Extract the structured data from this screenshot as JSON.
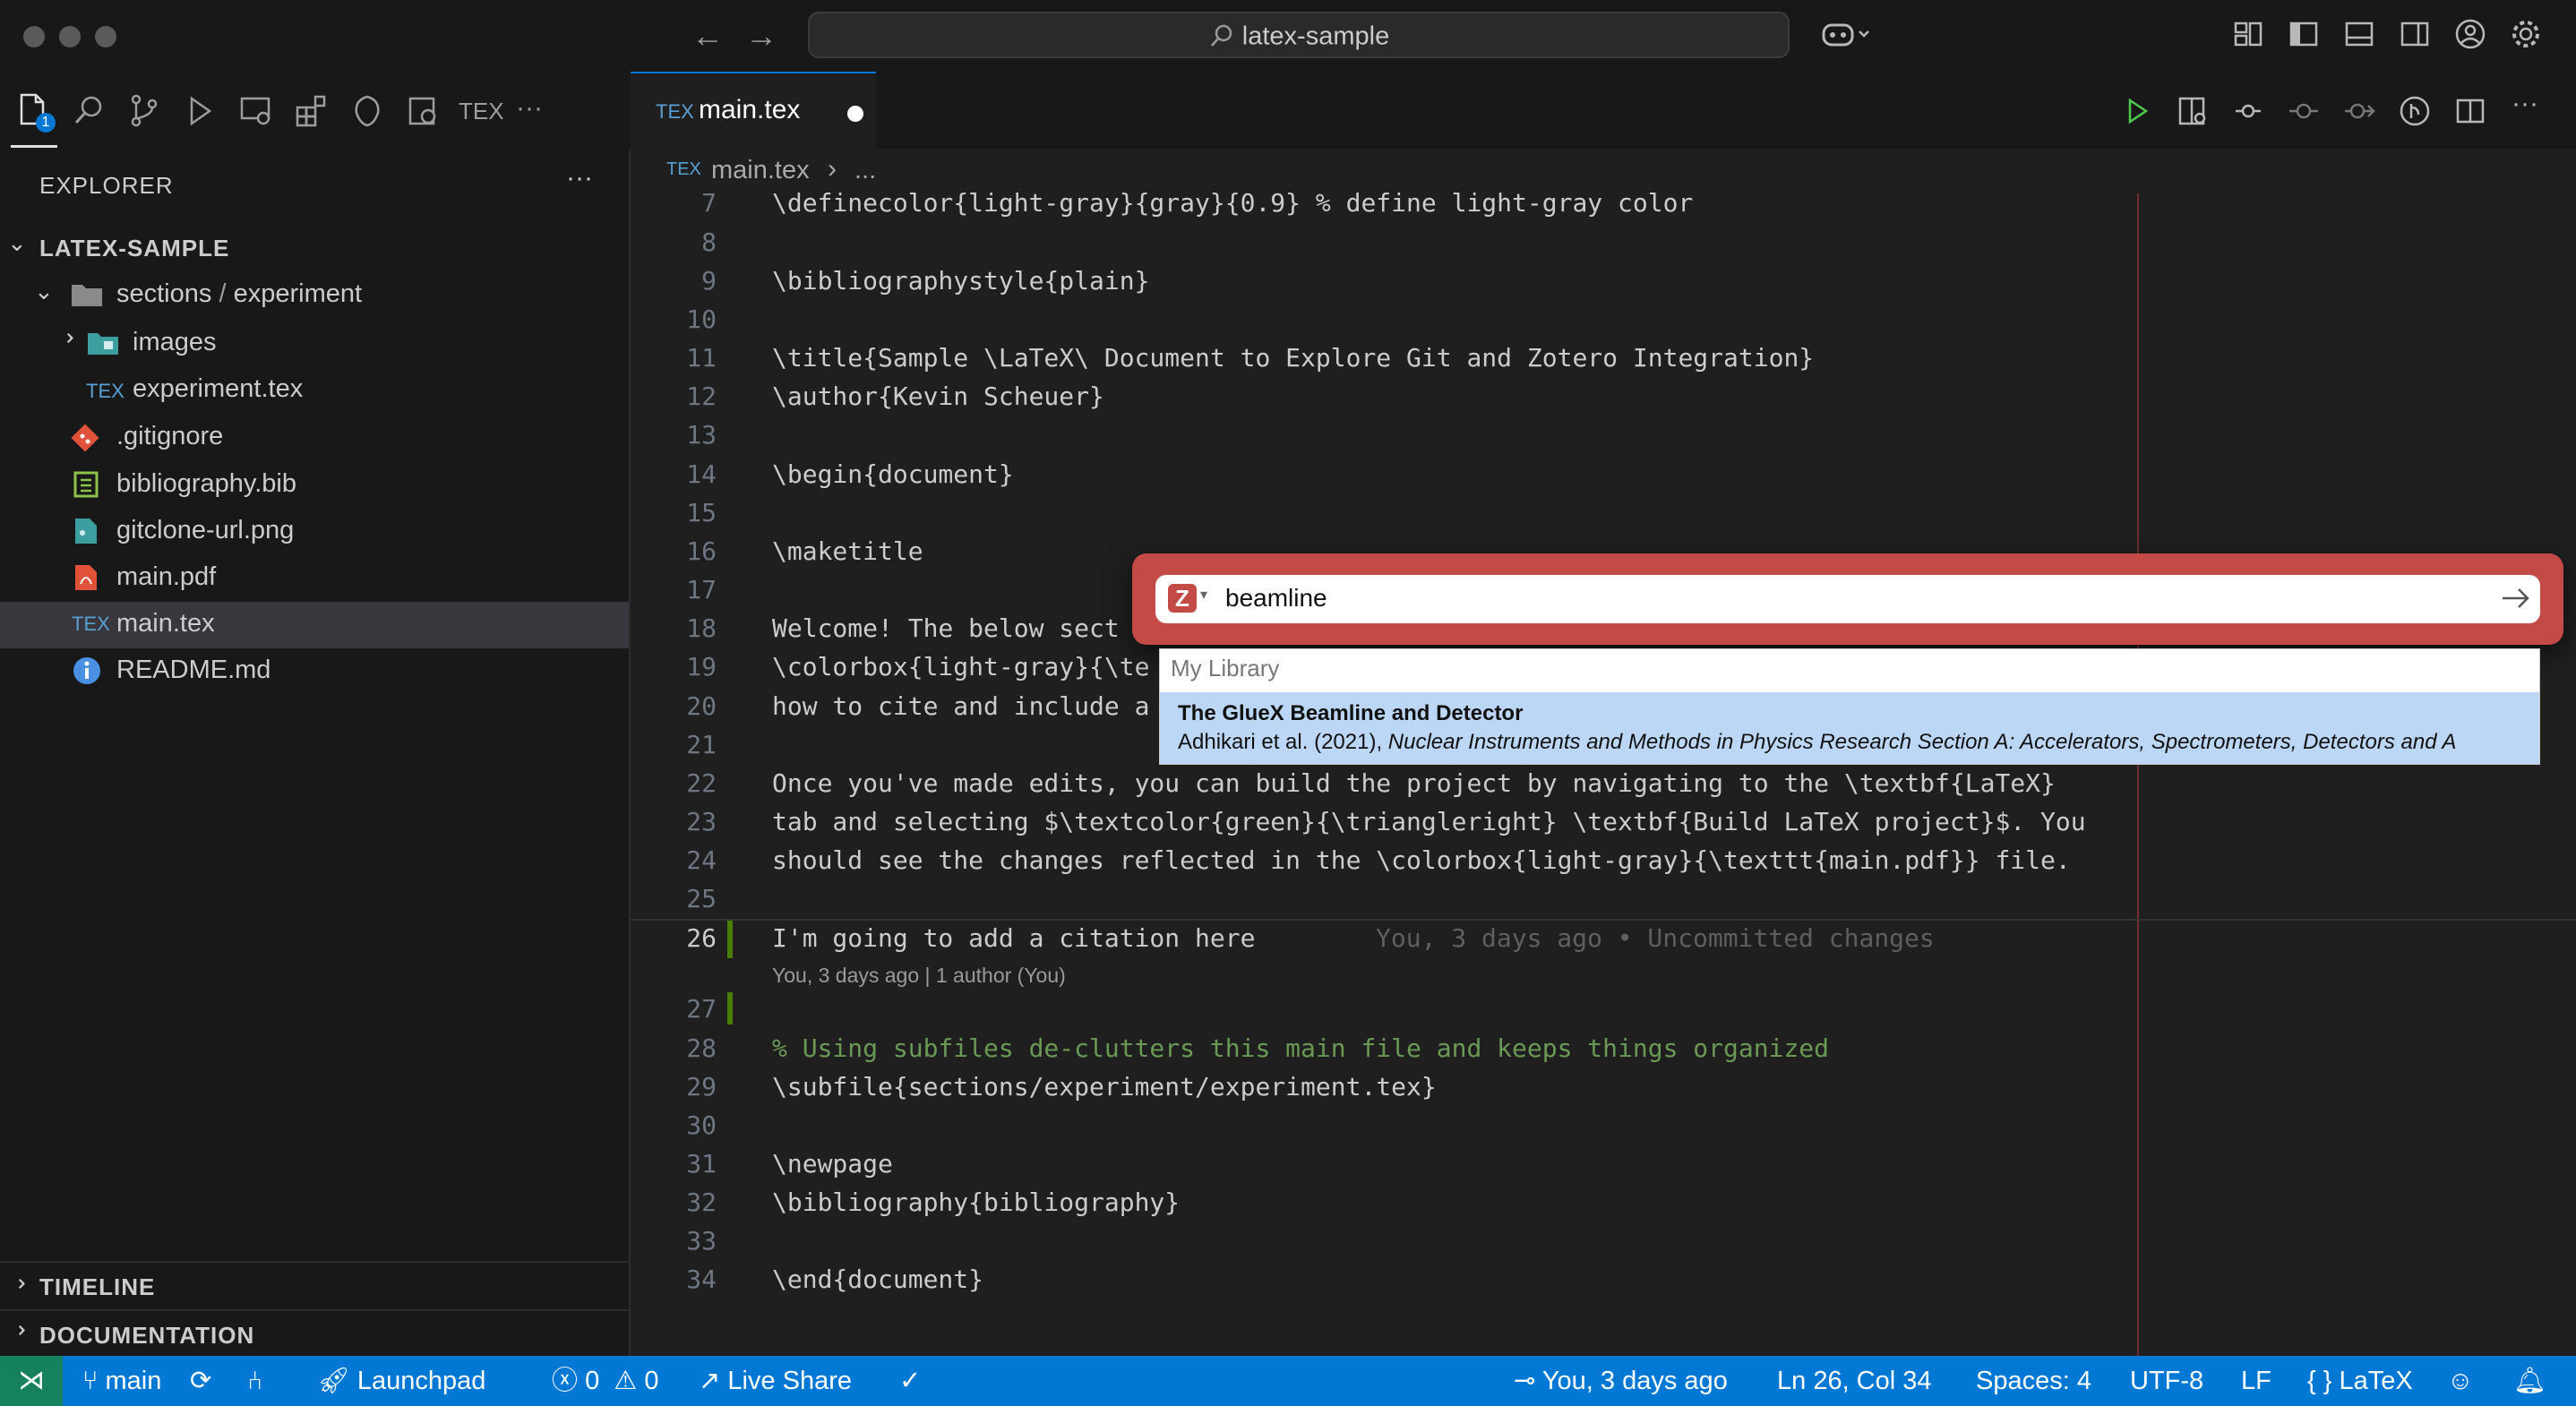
{
  "window": {
    "title": "latex-sample"
  },
  "activity": {
    "explorer_badge": "1",
    "tex_label": "TEX",
    "more": "···"
  },
  "sidebar": {
    "header": "EXPLORER",
    "more": "···",
    "project": "LATEX-SAMPLE",
    "folder_a": "sections",
    "folder_sep": "/",
    "folder_b": "experiment",
    "items": [
      {
        "label": "images"
      },
      {
        "label": "experiment.tex"
      },
      {
        "label": ".gitignore"
      },
      {
        "label": "bibliography.bib"
      },
      {
        "label": "gitclone-url.png"
      },
      {
        "label": "main.pdf"
      },
      {
        "label": "main.tex"
      },
      {
        "label": "README.md"
      }
    ],
    "timeline": "TIMELINE",
    "documentation": "DOCUMENTATION"
  },
  "tabs": {
    "active": "main.tex",
    "tex_glyph": "TEX"
  },
  "breadcrumb": {
    "file": "main.tex",
    "rest": "..."
  },
  "editor": {
    "lines": [
      {
        "n": "7",
        "text": "\\definecolor{light-gray}{gray}{0.9} % define light-gray color"
      },
      {
        "n": "8",
        "text": ""
      },
      {
        "n": "9",
        "text": "\\bibliographystyle{plain}"
      },
      {
        "n": "10",
        "text": ""
      },
      {
        "n": "11",
        "text": "\\title{Sample \\LaTeX\\ Document to Explore Git and Zotero Integration}"
      },
      {
        "n": "12",
        "text": "\\author{Kevin Scheuer}"
      },
      {
        "n": "13",
        "text": ""
      },
      {
        "n": "14",
        "text": "\\begin{document}"
      },
      {
        "n": "15",
        "text": ""
      },
      {
        "n": "16",
        "text": "\\maketitle"
      },
      {
        "n": "17",
        "text": ""
      },
      {
        "n": "18",
        "text": "Welcome! The below sect"
      },
      {
        "n": "19",
        "text": "\\colorbox{light-gray}{\\te"
      },
      {
        "n": "20",
        "text": "how to cite and include a"
      },
      {
        "n": "21",
        "text": ""
      },
      {
        "n": "22",
        "text": "Once you've made edits, you can build the project by navigating to the \\textbf{LaTeX}"
      },
      {
        "n": "23",
        "text": "tab and selecting $\\textcolor{green}{\\triangleright} \\textbf{Build LaTeX project}$. You"
      },
      {
        "n": "24",
        "text": "should see the changes reflected in the \\colorbox{light-gray}{\\texttt{main.pdf}} file."
      },
      {
        "n": "25",
        "text": ""
      },
      {
        "n": "26",
        "text": "I'm going to add a citation here"
      },
      {
        "n": "27",
        "text": ""
      },
      {
        "n": "28",
        "text": "% Using subfiles de-clutters this main file and keeps things organized"
      },
      {
        "n": "29",
        "text": "\\subfile{sections/experiment/experiment.tex}"
      },
      {
        "n": "30",
        "text": ""
      },
      {
        "n": "31",
        "text": "\\newpage"
      },
      {
        "n": "32",
        "text": "\\bibliography{bibliography}"
      },
      {
        "n": "33",
        "text": ""
      },
      {
        "n": "34",
        "text": "\\end{document}"
      }
    ],
    "blame_inline": "You, 3 days ago • Uncommitted changes",
    "codelens": "You, 3 days ago | 1 author (You)"
  },
  "zotero": {
    "search_value": "beamline",
    "group": "My Library",
    "result_title": "The GlueX Beamline and Detector",
    "result_authors": "Adhikari et al. (2021), ",
    "result_journal": "Nuclear Instruments and Methods in Physics Research Section A: Accelerators, Spectrometers, Detectors and A"
  },
  "statusbar": {
    "branch": "main",
    "launchpad": "Launchpad",
    "errors": "0",
    "warnings": "0",
    "liveshare": "Live Share",
    "blame": "You, 3 days ago",
    "position": "Ln 26, Col 34",
    "spaces": "Spaces: 4",
    "encoding": "UTF-8",
    "eol": "LF",
    "braces": "{ }",
    "language": "LaTeX"
  },
  "colors": {
    "accent": "#0078d4",
    "zotero": "#c44a45",
    "selection": "#bcd6f5"
  }
}
